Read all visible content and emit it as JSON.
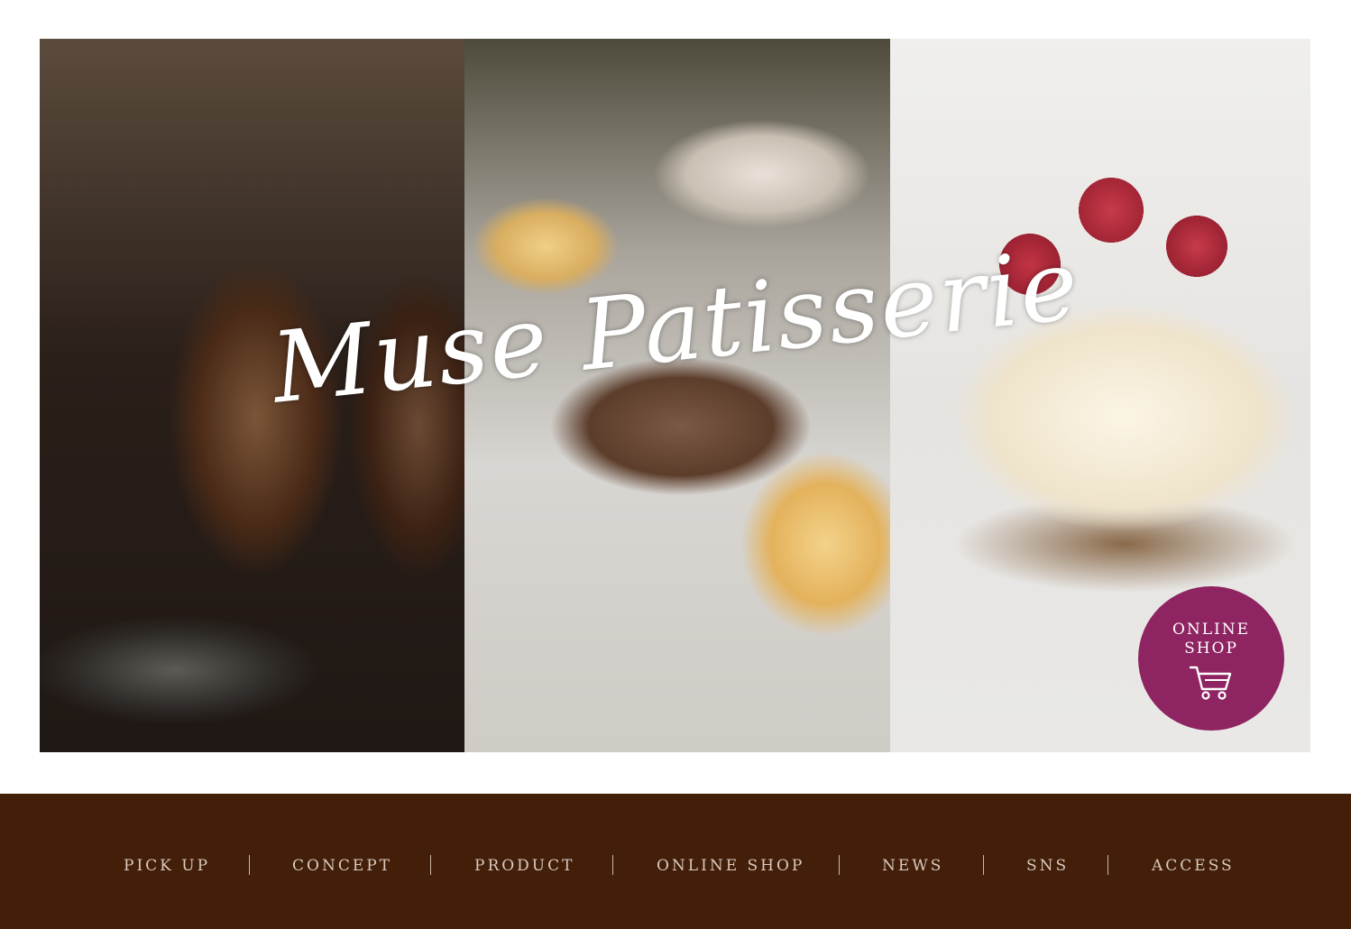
{
  "hero": {
    "title": "Muse Patisserie",
    "panels": [
      "caneles",
      "macarons",
      "cheesecake"
    ]
  },
  "online_shop": {
    "line1": "ONLINE",
    "line2": "SHOP",
    "icon": "cart-icon",
    "color": "#8e2461"
  },
  "nav": {
    "items": [
      "PICK UP",
      "CONCEPT",
      "PRODUCT",
      "ONLINE SHOP",
      "NEWS",
      "SNS",
      "ACCESS"
    ]
  },
  "colors": {
    "footer_bg": "#431e09",
    "nav_text": "#d9cbbf"
  }
}
